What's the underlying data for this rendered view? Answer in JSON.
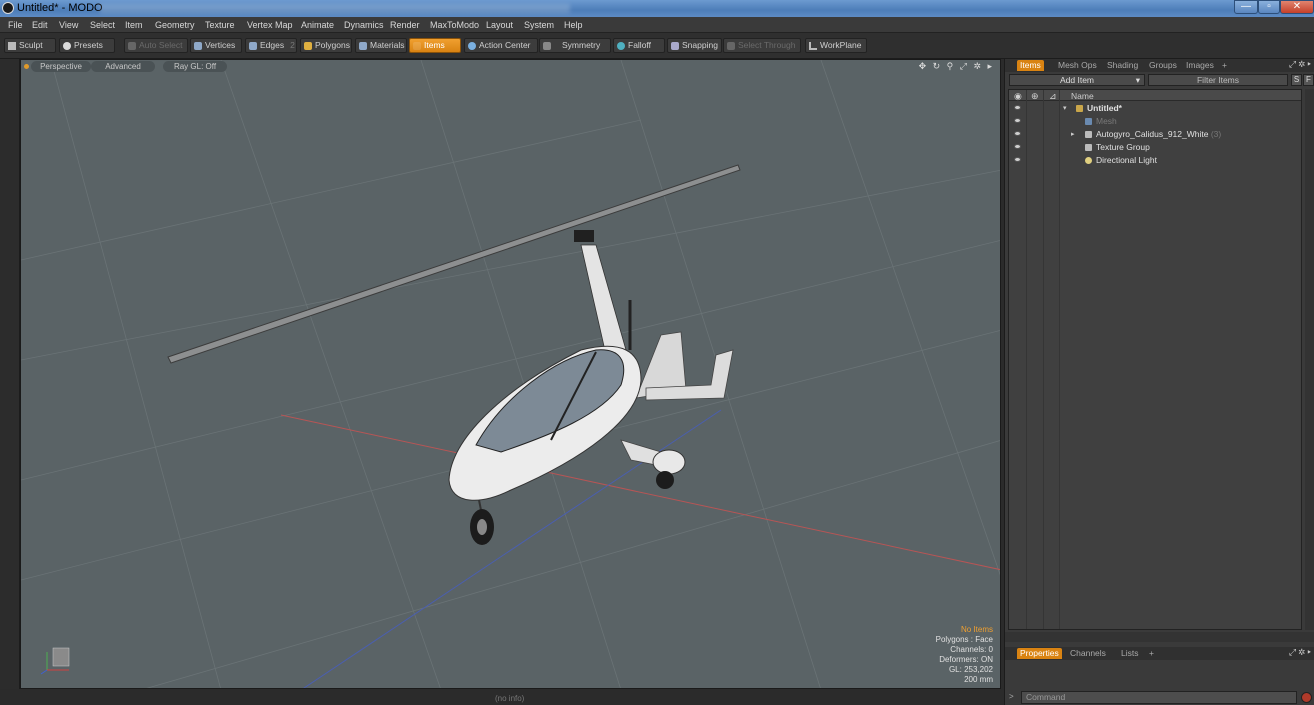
{
  "window": {
    "title": "Untitled* - MODO",
    "controls": {
      "minimize": "—",
      "maximize": "▫",
      "close": "✕"
    }
  },
  "menu": [
    "File",
    "Edit",
    "View",
    "Select",
    "Item",
    "Geometry",
    "Texture",
    "Vertex Map",
    "Animate",
    "Dynamics",
    "Render",
    "MaxToModo",
    "Layout",
    "System",
    "Help"
  ],
  "toolbar": {
    "sculpt": "Sculpt",
    "presets": "Presets",
    "auto_select": "Auto Select",
    "vertices": "Vertices",
    "edges": "Edges",
    "edges_count": "2",
    "polygons": "Polygons",
    "materials": "Materials",
    "items": "Items",
    "action_center": "Action Center",
    "symmetry": "Symmetry",
    "falloff": "Falloff",
    "snapping": "Snapping",
    "select_through": "Select Through",
    "workplane": "WorkPlane"
  },
  "viewport": {
    "tabs": [
      "Perspective",
      "Advanced",
      "Ray GL: Off"
    ],
    "icons": "✥ ↻ ⚲ ⤢ ✲ ▸",
    "info": {
      "status": "No Items",
      "polygons": "Polygons : Face",
      "channels": "Channels: 0",
      "deformers": "Deformers: ON",
      "gl": "GL: 253,202",
      "scale": "200 mm"
    }
  },
  "status_bar": "(no info)",
  "items_panel": {
    "tabs": [
      "Items",
      "Mesh Ops",
      "Shading",
      "Groups",
      "Images",
      "+"
    ],
    "add_item": "Add Item",
    "filter_placeholder": "Filter Items",
    "s_button": "S",
    "f_button": "F",
    "column_name": "Name",
    "tree": [
      {
        "label": "Untitled*",
        "icon": "scene-icon",
        "expanded": true
      },
      {
        "label": "Mesh",
        "icon": "mesh-icon",
        "dim": true
      },
      {
        "label": "Autogyro_Calidus_912_White",
        "count": "(3)",
        "icon": "locator-icon"
      },
      {
        "label": "Texture Group",
        "icon": "texture-group-icon"
      },
      {
        "label": "Directional Light",
        "icon": "light-icon"
      }
    ]
  },
  "properties_panel": {
    "tabs": [
      "Properties",
      "Channels",
      "Lists",
      "+"
    ]
  },
  "command": {
    "prompt": ">",
    "placeholder": "Command"
  }
}
